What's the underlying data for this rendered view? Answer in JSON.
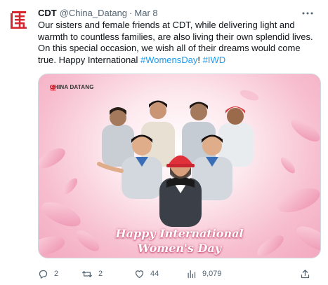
{
  "tweet": {
    "author_name": "CDT",
    "handle": "@China_Datang",
    "separator": "·",
    "date": "Mar 8",
    "text_before": "Our sisters and female friends at CDT, while delivering light and warmth to countless families, are also living their own splendid lives. On this special occasion, we wish all of their dreams would come true. Happy International ",
    "hashtag1": "#WomensDay",
    "text_between": "! ",
    "hashtag2": "#IWD"
  },
  "media": {
    "brand": "CHINA DATANG",
    "headline_line1": "Happy International",
    "headline_line2": "Women's Day"
  },
  "actions": {
    "reply_count": "2",
    "retweet_count": "2",
    "like_count": "44",
    "view_count": "9,079"
  },
  "colors": {
    "brand_red": "#d7252f",
    "link_blue": "#1d9bf0",
    "muted_gray": "#536471",
    "pink_bg": "#f7bfd0"
  },
  "icons": [
    "cdt-logo-icon",
    "more-icon",
    "reply-icon",
    "retweet-icon",
    "like-icon",
    "views-icon",
    "share-icon"
  ]
}
